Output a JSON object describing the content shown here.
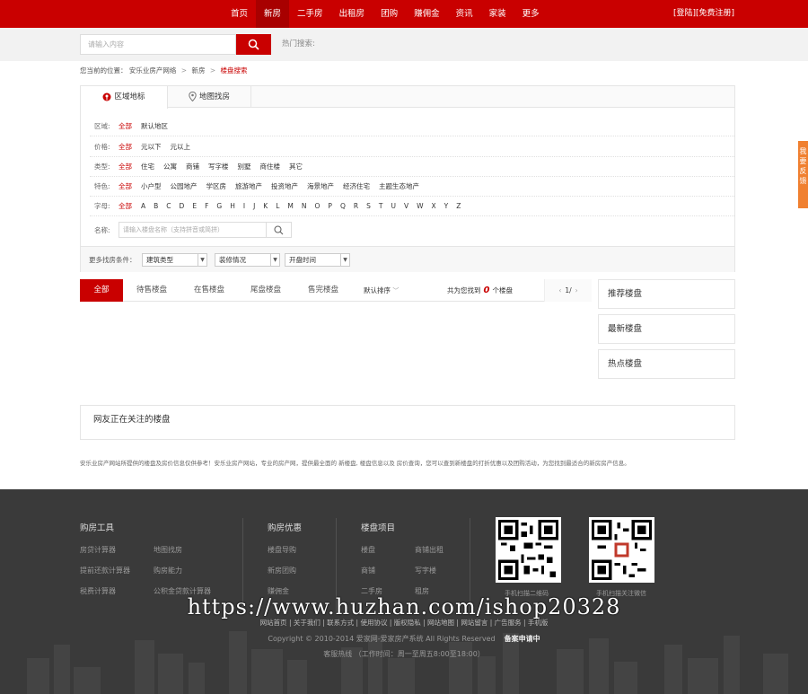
{
  "topnav": {
    "items": [
      "首页",
      "新房",
      "二手房",
      "出租房",
      "团购",
      "赚佣金",
      "资讯",
      "家装",
      "更多"
    ],
    "active_index": 1,
    "login": "[登陆]",
    "register": "[免费注册]"
  },
  "search": {
    "placeholder": "请输入内容",
    "hot_label": "热门搜索:"
  },
  "breadcrumb": {
    "prefix": "您当前的位置：",
    "items": [
      "安乐业房产网络",
      "新房",
      "楼盘搜索"
    ]
  },
  "filter": {
    "tabs": [
      "区域地标",
      "地图找房"
    ],
    "rows": [
      {
        "label": "区域:",
        "options": [
          "全部",
          "默认地区"
        ]
      },
      {
        "label": "价格:",
        "options": [
          "全部",
          "元以下",
          "元以上"
        ]
      },
      {
        "label": "类型:",
        "options": [
          "全部",
          "住宅",
          "公寓",
          "商铺",
          "写字楼",
          "别墅",
          "商住楼",
          "其它"
        ]
      },
      {
        "label": "特色:",
        "options": [
          "全部",
          "小户型",
          "公园地产",
          "学区房",
          "旅游地产",
          "投资地产",
          "海景地产",
          "经济住宅",
          "主题生态地产"
        ]
      },
      {
        "label": "字母:",
        "options": [
          "全部",
          "A",
          "B",
          "C",
          "D",
          "E",
          "F",
          "G",
          "H",
          "I",
          "J",
          "K",
          "L",
          "M",
          "N",
          "O",
          "P",
          "Q",
          "R",
          "S",
          "T",
          "U",
          "V",
          "W",
          "X",
          "Y",
          "Z"
        ]
      }
    ],
    "name_label": "名称:",
    "name_placeholder": "请输入楼盘名称（支持拼音或简拼）",
    "more_label": "更多找房条件：",
    "dropdowns": [
      "建筑类型",
      "装修情况",
      "开盘时间"
    ]
  },
  "list": {
    "tabs": [
      "全部",
      "待售楼盘",
      "在售楼盘",
      "尾盘楼盘",
      "售完楼盘"
    ],
    "sort": "默认排序",
    "found_prefix": "共为您找到",
    "found_count": "0",
    "found_suffix": "个楼盘",
    "pager": "1/"
  },
  "sidebar": [
    "推荐楼盘",
    "最新楼盘",
    "热点楼盘"
  ],
  "watching_title": "网友正在关注的楼盘",
  "disclaimer": "安乐业房产网站所提供的楼盘及房价信息仅供参考！安乐业房产网站，专业的房产网，提供最全面的 新楼盘, 楼盘信息以及 房价查询，您可以查到新楼盘的打折优惠以及团购活动，为您找到最适合的新房房产信息。",
  "feedback": "我要反馈",
  "footer": {
    "col1": {
      "title": "购房工具",
      "links": [
        "房贷计算器",
        "地图找房",
        "提前还款计算器",
        "购房能力",
        "税费计算器",
        "公积金贷款计算器"
      ]
    },
    "col2": {
      "title": "购房优惠",
      "links": [
        "楼盘导购",
        "新房团购",
        "赚佣金"
      ]
    },
    "col3": {
      "title": "楼盘项目",
      "links": [
        "楼盘",
        "商铺出租",
        "商铺",
        "写字楼",
        "二手房",
        "租房"
      ]
    },
    "qr1_caption": "手机扫描二维码",
    "qr2_caption": "手机扫描关注微信",
    "links": "网站首页 | 关于我们 | 联系方式 | 使用协议 | 版权隐私 | 网站地图 | 网站留言 | 广告服务 | 手机版",
    "copyright": "Copyright © 2010-2014 爱家网-爱家房产系统 All Rights Reserved",
    "icp": "备案申请中",
    "hotline": "客服热线 （工作时间：周一至周五8:00至18:00）"
  },
  "watermark": "https://www.huzhan.com/ishop20328"
}
